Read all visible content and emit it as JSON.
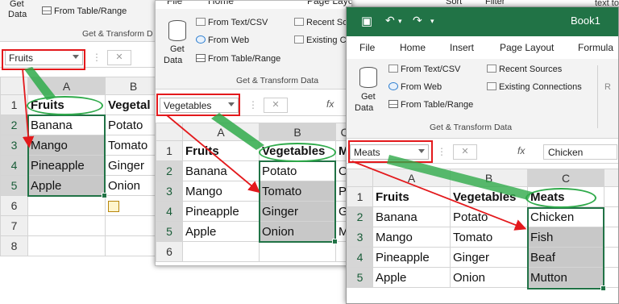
{
  "w1": {
    "ribbon_items": [
      "Get",
      "Data",
      "From Table/Range"
    ],
    "group_title": "Get & Transform D",
    "name_box": "Fruits",
    "cancel": "✕",
    "cols": [
      "A",
      "B"
    ],
    "rows": [
      "1",
      "2",
      "3",
      "4",
      "5",
      "6",
      "7",
      "8"
    ],
    "cells_a": [
      "Fruits",
      "Banana",
      "Mango",
      "Pineapple",
      "Apple"
    ],
    "cells_b": [
      "Vegetal",
      "Potato",
      "Tomato",
      "Ginger",
      "Onion"
    ]
  },
  "w2": {
    "tabs": [
      "File",
      "Home",
      "Page Layout"
    ],
    "get_label": "Get",
    "data_label": "Data",
    "from_text": "From Text/CSV",
    "from_web": "From Web",
    "from_table": "From Table/Range",
    "recent": "Recent So",
    "existing": "Existing C",
    "group_title": "Get & Transform Data",
    "name_box": "Vegetables",
    "fx": "fx",
    "cancel": "✕",
    "cols": [
      "A",
      "B",
      "C"
    ],
    "rows": [
      "1",
      "2",
      "3",
      "4",
      "5",
      "6"
    ],
    "cells_a": [
      "Fruits",
      "Banana",
      "Mango",
      "Pineapple",
      "Apple"
    ],
    "cells_b": [
      "Vegetables",
      "Potato",
      "Tomato",
      "Ginger",
      "Onion"
    ],
    "cells_c": [
      "M",
      "O",
      "P",
      "G",
      "M"
    ]
  },
  "w3": {
    "title": "Book1",
    "undo_icon": "undo-icon",
    "tabs": [
      "File",
      "Home",
      "Insert",
      "Page Layout",
      "Formula"
    ],
    "get_label": "Get",
    "data_label": "Data",
    "from_text": "From Text/CSV",
    "from_web": "From Web",
    "from_table": "From Table/Range",
    "recent": "Recent Sources",
    "existing": "Existing Connections",
    "group_title": "Get & Transform Data",
    "name_box": "Meats",
    "fx": "fx",
    "formula_value": "Chicken",
    "cancel": "✕",
    "cols": [
      "A",
      "B",
      "C"
    ],
    "rows": [
      "1",
      "2",
      "3",
      "4",
      "5"
    ],
    "cells_a": [
      "Fruits",
      "Banana",
      "Mango",
      "Pineapple",
      "Apple"
    ],
    "cells_b": [
      "Vegetables",
      "Potato",
      "Tomato",
      "Ginger",
      "Onion"
    ],
    "cells_c": [
      "Meats",
      "Chicken",
      "Fish",
      "Beaf",
      "Mutton"
    ]
  },
  "top_fragments": {
    "from": "Filter",
    "sort": "Sort",
    "text_to": "text to"
  },
  "colors": {
    "excel_green": "#217346",
    "highlight_red": "#e3191c",
    "highlight_green": "#2faa4a"
  }
}
